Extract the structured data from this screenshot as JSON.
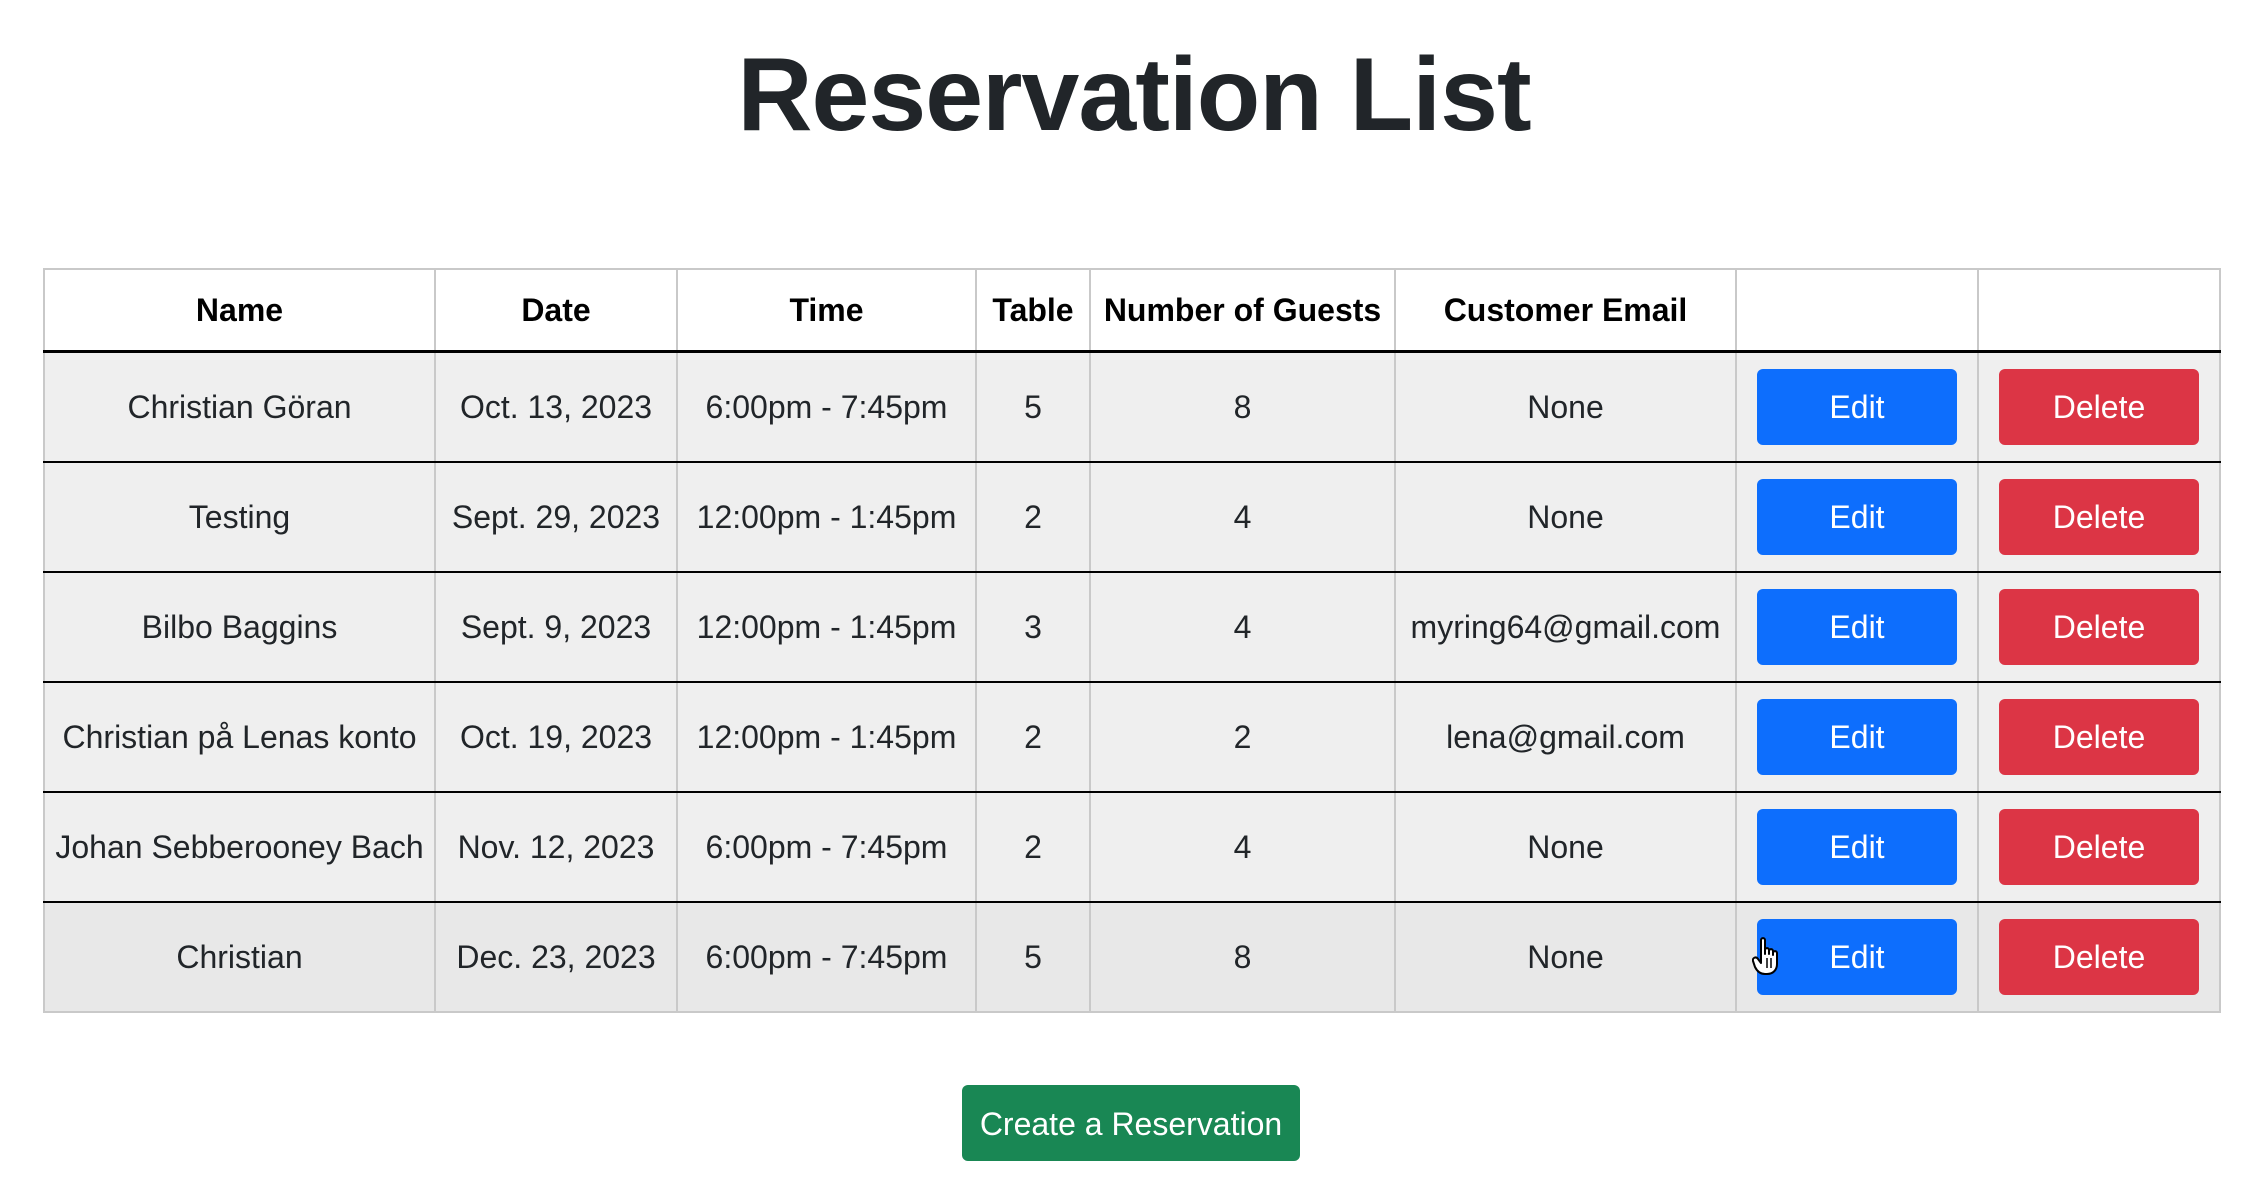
{
  "page": {
    "title": "Reservation List"
  },
  "table": {
    "headers": [
      "Name",
      "Date",
      "Time",
      "Table",
      "Number of Guests",
      "Customer Email",
      "",
      ""
    ],
    "rows": [
      {
        "name": "Christian Göran",
        "date": "Oct. 13, 2023",
        "time": "6:00pm - 7:45pm",
        "table": "5",
        "guests": "8",
        "email": "None"
      },
      {
        "name": "Testing",
        "date": "Sept. 29, 2023",
        "time": "12:00pm - 1:45pm",
        "table": "2",
        "guests": "4",
        "email": "None"
      },
      {
        "name": "Bilbo Baggins",
        "date": "Sept. 9, 2023",
        "time": "12:00pm - 1:45pm",
        "table": "3",
        "guests": "4",
        "email": "myring64@gmail.com"
      },
      {
        "name": "Christian på Lenas konto",
        "date": "Oct. 19, 2023",
        "time": "12:00pm - 1:45pm",
        "table": "2",
        "guests": "2",
        "email": "lena@gmail.com"
      },
      {
        "name": "Johan Sebberooney Bach",
        "date": "Nov. 12, 2023",
        "time": "6:00pm - 7:45pm",
        "table": "2",
        "guests": "4",
        "email": "None"
      },
      {
        "name": "Christian",
        "date": "Dec. 23, 2023",
        "time": "6:00pm - 7:45pm",
        "table": "5",
        "guests": "8",
        "email": "None"
      }
    ],
    "edit_label": "Edit",
    "delete_label": "Delete"
  },
  "actions": {
    "create_label": "Create a Reservation"
  },
  "colors": {
    "edit": "#0d6efd",
    "delete": "#dc3545",
    "create": "#198754"
  },
  "icons": {
    "cursor": "hand-pointer-icon"
  }
}
